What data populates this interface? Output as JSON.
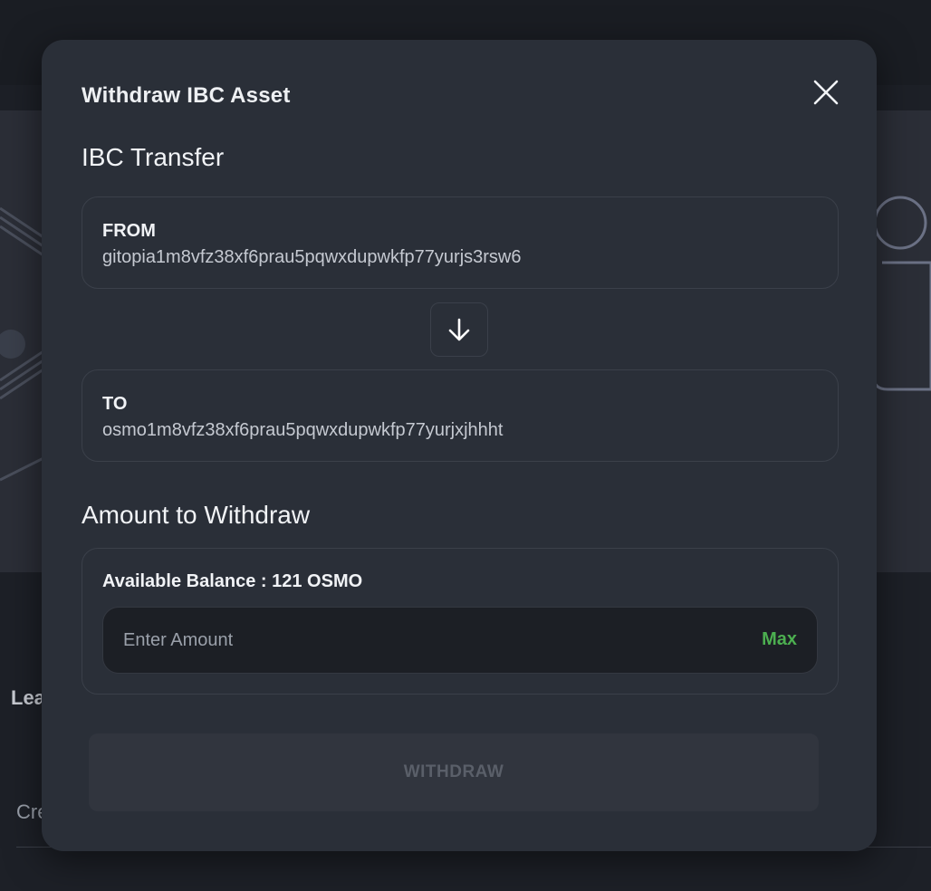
{
  "background": {
    "partial_heading": "Lea",
    "partial_text": "Cre"
  },
  "modal": {
    "title": "Withdraw IBC Asset",
    "close_icon": "close-icon",
    "transfer_section": {
      "title": "IBC Transfer",
      "from": {
        "label": "FROM",
        "address": "gitopia1m8vfz38xf6prau5pqwxdupwkfp77yurjs3rsw6"
      },
      "swap_icon": "arrow-down-icon",
      "to": {
        "label": "TO",
        "address": "osmo1m8vfz38xf6prau5pqwxdupwkfp77yurjxjhhht"
      }
    },
    "amount_section": {
      "title": "Amount to Withdraw",
      "balance_label": "Available Balance : 121 OSMO",
      "input_placeholder": "Enter Amount",
      "input_value": "",
      "max_label": "Max"
    },
    "withdraw_label": "WITHDRAW"
  },
  "colors": {
    "modal_bg": "#2a2f38",
    "accent_green": "#4caf50",
    "disabled_button_bg": "#31353e",
    "disabled_button_text": "#5a5f69"
  }
}
